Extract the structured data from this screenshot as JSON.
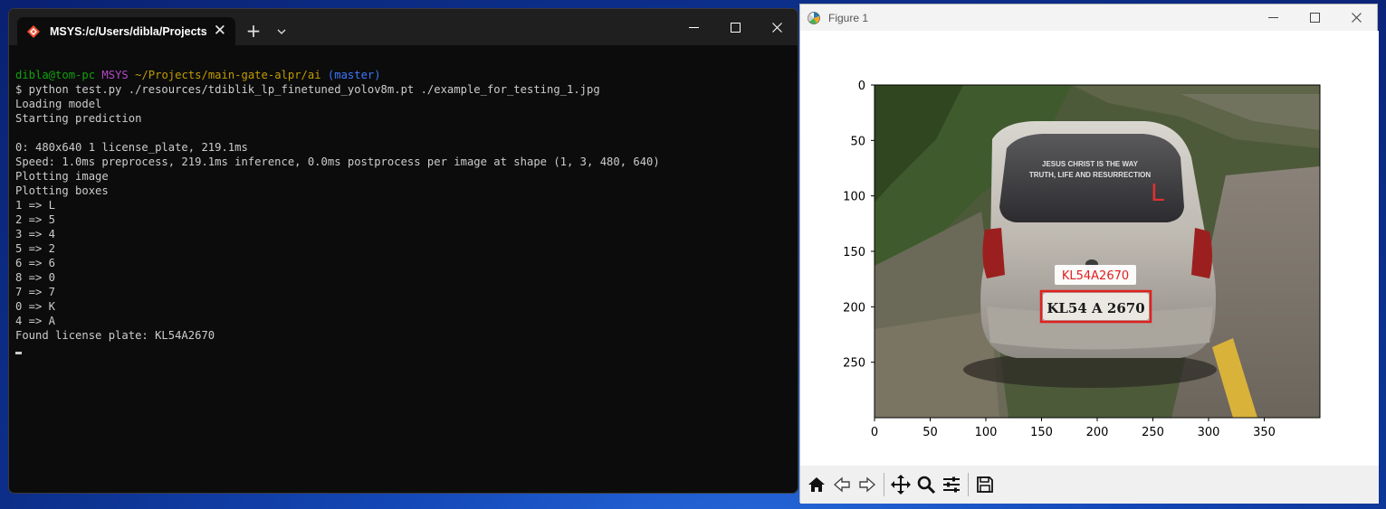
{
  "terminal": {
    "tab_title": "MSYS:/c/Users/dibla/Projects/",
    "new_tab_symbol": "+",
    "prompt": {
      "user_host": "dibla@tom-pc",
      "system": "MSYS",
      "path": "~/Projects/main-gate-alpr/ai",
      "branch": "(master)"
    },
    "command": "$ python test.py ./resources/tdiblik_lp_finetuned_yolov8m.pt ./example_for_testing_1.jpg",
    "output_lines": [
      "Loading model",
      "Starting prediction",
      "",
      "0: 480x640 1 license_plate, 219.1ms",
      "Speed: 1.0ms preprocess, 219.1ms inference, 0.0ms postprocess per image at shape (1, 3, 480, 640)",
      "Plotting image",
      "Plotting boxes",
      "1 => L",
      "2 => 5",
      "3 => 4",
      "5 => 2",
      "6 => 6",
      "8 => 0",
      "7 => 7",
      "0 => K",
      "4 => A",
      "Found license plate: KL54A2670"
    ],
    "colors": {
      "background": "#0c0c0c",
      "text": "#cccccc",
      "user_host": "#13a10e",
      "system": "#b148c6",
      "path": "#c19c00",
      "branch": "#3b78ff"
    }
  },
  "figure": {
    "title": "Figure 1",
    "axes": {
      "x_ticks": [
        "0",
        "50",
        "100",
        "150",
        "200",
        "250",
        "300",
        "350"
      ],
      "y_ticks": [
        "0",
        "50",
        "100",
        "150",
        "200",
        "250"
      ]
    },
    "detection_label": "KL54A2670",
    "plate_text": "KL54 A 2670",
    "windshield_text_line1": "JESUS CHRIST IS THE WAY",
    "windshield_text_line2": "TRUTH, LIFE AND RESURRECTION",
    "windshield_sticker": "L",
    "box_color": "#e02020",
    "toolbar_icons": [
      "home-icon",
      "back-icon",
      "forward-icon",
      "pan-icon",
      "zoom-icon",
      "configure-subplots-icon",
      "save-icon"
    ]
  }
}
